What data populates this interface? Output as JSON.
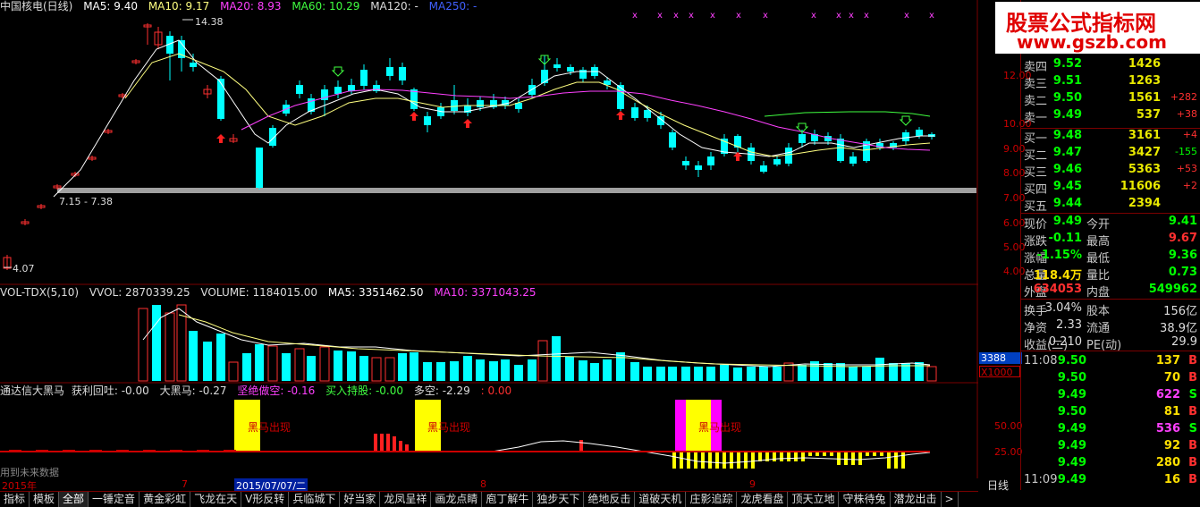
{
  "header": {
    "stock_name": "中国核电(日线)",
    "ma5": "MA5: 9.40",
    "ma10": "MA10: 9.17",
    "ma20": "MA20: 8.93",
    "ma60": "MA60: 10.29",
    "ma120": "MA120: -",
    "ma250": "MA250: -"
  },
  "price_chart": {
    "high_label": "14.38",
    "low_label": "4.07",
    "range_label": "7.15 - 7.38",
    "y_ticks": [
      "12.00",
      "11.00",
      "10.00",
      "9.00",
      "8.00",
      "7.00",
      "6.00",
      "5.00",
      "4.00"
    ]
  },
  "volume_header": {
    "name": "VOL-TDX(5,10)",
    "vvol": "VVOL: 2870339.25",
    "volume": "VOLUME: 1184015.00",
    "ma5": "MA5: 3351462.50",
    "ma10": "MA10: 3371043.25",
    "y_tick": "10000",
    "unit_top": "3388",
    "unit_mult": "X1000"
  },
  "indicator_header": {
    "name": "通达信大黑马",
    "profit": "获利回吐: -0.00",
    "dahei": "大黑马: -0.27",
    "jueji": "坚绝做空: -0.16",
    "mairu": "买入持股: -0.00",
    "duokong": "多空: -2.29",
    "extra": ": 0.00",
    "y_ticks": [
      "50.00",
      "25.00"
    ],
    "signal_text": "黑马出现",
    "future_note": "用到未来数据"
  },
  "xaxis": {
    "year": "2015年",
    "m7": "7",
    "date_box": "2015/07/07/二",
    "m8": "8",
    "m9": "9",
    "period": "日线"
  },
  "tabs": [
    "指标",
    "模板",
    "全部",
    "一锤定音",
    "黄金彩虹",
    "飞龙在天",
    "V形反转",
    "兵临城下",
    "好当家",
    "龙凤呈祥",
    "画龙点睛",
    "庖丁解牛",
    "独步天下",
    "绝地反击",
    "道破天机",
    "庄影追踪",
    "龙虎看盘",
    "顶天立地",
    "守株待兔",
    "潜龙出击",
    ">"
  ],
  "watermark": {
    "title": "股票公式指标网",
    "url": "www.gszb.com"
  },
  "orderbook": {
    "asks": [
      {
        "label": "卖四",
        "price": "9.52",
        "vol": "1426",
        "chg": ""
      },
      {
        "label": "卖三",
        "price": "9.51",
        "vol": "1263",
        "chg": ""
      },
      {
        "label": "卖二",
        "price": "9.50",
        "vol": "1561",
        "chg": "+282"
      },
      {
        "label": "卖一",
        "price": "9.49",
        "vol": "537",
        "chg": "+38"
      }
    ],
    "bids": [
      {
        "label": "买一",
        "price": "9.48",
        "vol": "3161",
        "chg": "+4"
      },
      {
        "label": "买二",
        "price": "9.47",
        "vol": "3427",
        "chg": "-155"
      },
      {
        "label": "买三",
        "price": "9.46",
        "vol": "5363",
        "chg": "+53"
      },
      {
        "label": "买四",
        "price": "9.45",
        "vol": "11606",
        "chg": "+2"
      },
      {
        "label": "买五",
        "price": "9.44",
        "vol": "2394",
        "chg": ""
      }
    ]
  },
  "quote": [
    {
      "l1": "现价",
      "v1": "9.49",
      "l2": "今开",
      "v2": "9.41",
      "c1": "#00ff00",
      "c2": "#00ff00"
    },
    {
      "l1": "涨跌",
      "v1": "-0.11",
      "l2": "最高",
      "v2": "9.67",
      "c1": "#00ff00",
      "c2": "#ff3030"
    },
    {
      "l1": "涨幅",
      "v1": "-1.15%",
      "l2": "最低",
      "v2": "9.36",
      "c1": "#00ff00",
      "c2": "#00ff00"
    },
    {
      "l1": "总量",
      "v1": "118.4万",
      "l2": "量比",
      "v2": "0.73",
      "c1": "#ffe000",
      "c2": "#00ff00"
    },
    {
      "l1": "外盘",
      "v1": "634053",
      "l2": "内盘",
      "v2": "549962",
      "c1": "#ff3030",
      "c2": "#00ff00"
    }
  ],
  "stats": [
    {
      "l1": "换手",
      "v1": "3.04%",
      "l2": "股本",
      "v2": "156亿"
    },
    {
      "l1": "净资",
      "v1": "2.33",
      "l2": "流通",
      "v2": "38.9亿"
    },
    {
      "l1": "收益(二)",
      "v1": "0.210",
      "l2": "PE(动)",
      "v2": "29.9"
    }
  ],
  "ticks": [
    {
      "t": "11:08",
      "p": "9.50",
      "q": "137",
      "d": "B"
    },
    {
      "t": "",
      "p": "9.50",
      "q": "70",
      "d": "B"
    },
    {
      "t": "",
      "p": "9.49",
      "q": "622",
      "d": "S"
    },
    {
      "t": "",
      "p": "9.50",
      "q": "81",
      "d": "B"
    },
    {
      "t": "",
      "p": "9.49",
      "q": "536",
      "d": "S"
    },
    {
      "t": "",
      "p": "9.49",
      "q": "92",
      "d": "B"
    },
    {
      "t": "",
      "p": "9.49",
      "q": "280",
      "d": "B"
    },
    {
      "t": "11:09",
      "p": "9.49",
      "q": "16",
      "d": "B"
    }
  ],
  "colors": {
    "up": "#ff3030",
    "down": "#00ffff",
    "ma5": "#ffffff",
    "ma10": "#ffff80",
    "ma20": "#ff40ff",
    "ma60": "#40ff40",
    "grid": "#7a0000"
  }
}
